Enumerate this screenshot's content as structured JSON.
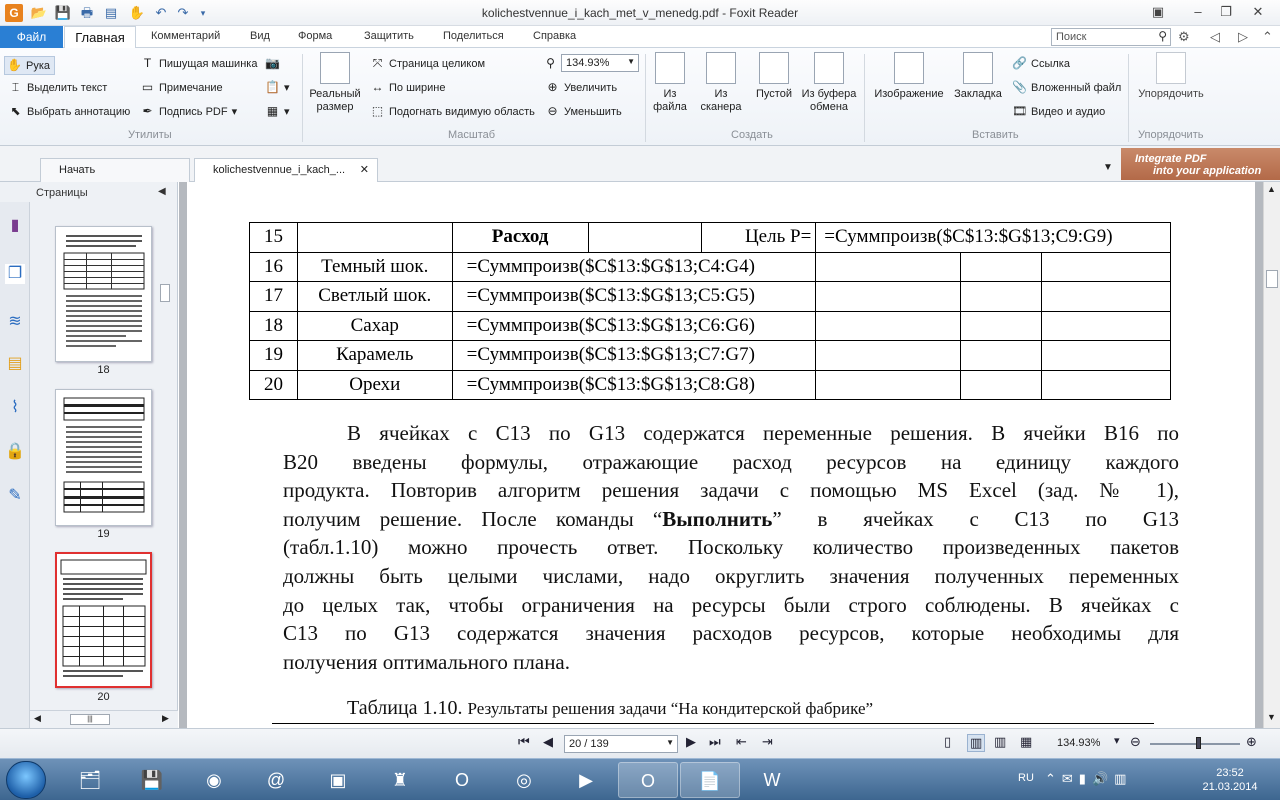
{
  "window": {
    "title": "kolichestvennue_i_kach_met_v_menedg.pdf - Foxit Reader"
  },
  "menu": {
    "file": "Файл",
    "tabs": [
      "Главная",
      "Комментарий",
      "Вид",
      "Форма",
      "Защитить",
      "Поделиться",
      "Справка"
    ],
    "search_placeholder": "Поиск"
  },
  "ribbon": {
    "utilities": {
      "hand": "Рука",
      "select_text": "Выделить текст",
      "select_annotation": "Выбрать аннотацию",
      "typewriter": "Пишущая машинка",
      "note": "Примечание",
      "sign_pdf": "Подпись PDF",
      "group": "Утилиты"
    },
    "zoom": {
      "actual_size": "Реальный размер",
      "fit_page": "Страница целиком",
      "fit_width": "По ширине",
      "fit_visible": "Подогнать видимую область",
      "value": "134.93%",
      "zoom_in": "Увеличить",
      "zoom_out": "Уменьшить",
      "group": "Масштаб"
    },
    "create": {
      "from_file": "Из файла",
      "from_scanner": "Из сканера",
      "blank": "Пустой",
      "from_clipboard": "Из буфера обмена",
      "group": "Создать"
    },
    "insert": {
      "image": "Изображение",
      "bookmark": "Закладка",
      "link": "Ссылка",
      "attachment": "Вложенный файл",
      "video_audio": "Видео и аудио",
      "group": "Вставить"
    },
    "arrange": {
      "label": "Упорядочить",
      "group": "Упорядочить"
    }
  },
  "doc_tabs": {
    "start": "Начать",
    "document": "kolichestvennue_i_kach_..."
  },
  "banner": {
    "line1": "Integrate PDF",
    "line2": "into your application"
  },
  "sidebar": {
    "title": "Страницы",
    "pages": [
      "18",
      "19",
      "20"
    ]
  },
  "table": {
    "rows": [
      [
        "15",
        "",
        "Расход",
        "",
        "Цель  P=",
        "=Суммпроизв($C$13:$G$13;C9:G9)"
      ],
      [
        "16",
        "Темный шок.",
        "=Суммпроизв($C$13:$G$13;C4:G4)"
      ],
      [
        "17",
        "Светлый шок.",
        "=Суммпроизв($C$13:$G$13;C5:G5)"
      ],
      [
        "18",
        "Сахар",
        "=Суммпроизв($C$13:$G$13;C6:G6)"
      ],
      [
        "19",
        "Карамель",
        "=Суммпроизв($C$13:$G$13;C7:G7)"
      ],
      [
        "20",
        "Орехи",
        "=Суммпроизв($C$13:$G$13;C8:G8)"
      ]
    ]
  },
  "paragraph": {
    "lines": [
      "В ячейках с C13 по G13 содержатся переменные решения. В ячейки B16 по",
      "B20 введены формулы, отражающие расход ресурсов на единицу каждого",
      "продукта. Повторив алгоритм решения задачи с помощью MS Excel (зад. № 1),",
      "получим решение. После команды “",
      "Выполнить",
      "” в ячейках с C13 по G13",
      "(табл.1.10) можно прочесть ответ. Поскольку количество произведенных пакетов",
      "должны быть целыми числами, надо округлить значения полученных переменных",
      "до целых так, чтобы ограничения на ресурсы были строго соблюдены. В ячейках с",
      "C13 по G13 содержатся значения расходов ресурсов, которые необходимы для",
      "получения оптимального плана."
    ]
  },
  "caption": {
    "label": "Таблица 1.10.",
    "text": "Результаты решения задачи “На кондитерской фабрике”"
  },
  "status": {
    "page": "20 / 139",
    "zoom": "134.93%"
  },
  "taskbar": {
    "lang": "RU",
    "time": "23:52",
    "date": "21.03.2014"
  },
  "colors": {
    "file_tab": "#2a7fd4",
    "selected_thumb": "#e03030",
    "taskbar": "#3d6690"
  }
}
